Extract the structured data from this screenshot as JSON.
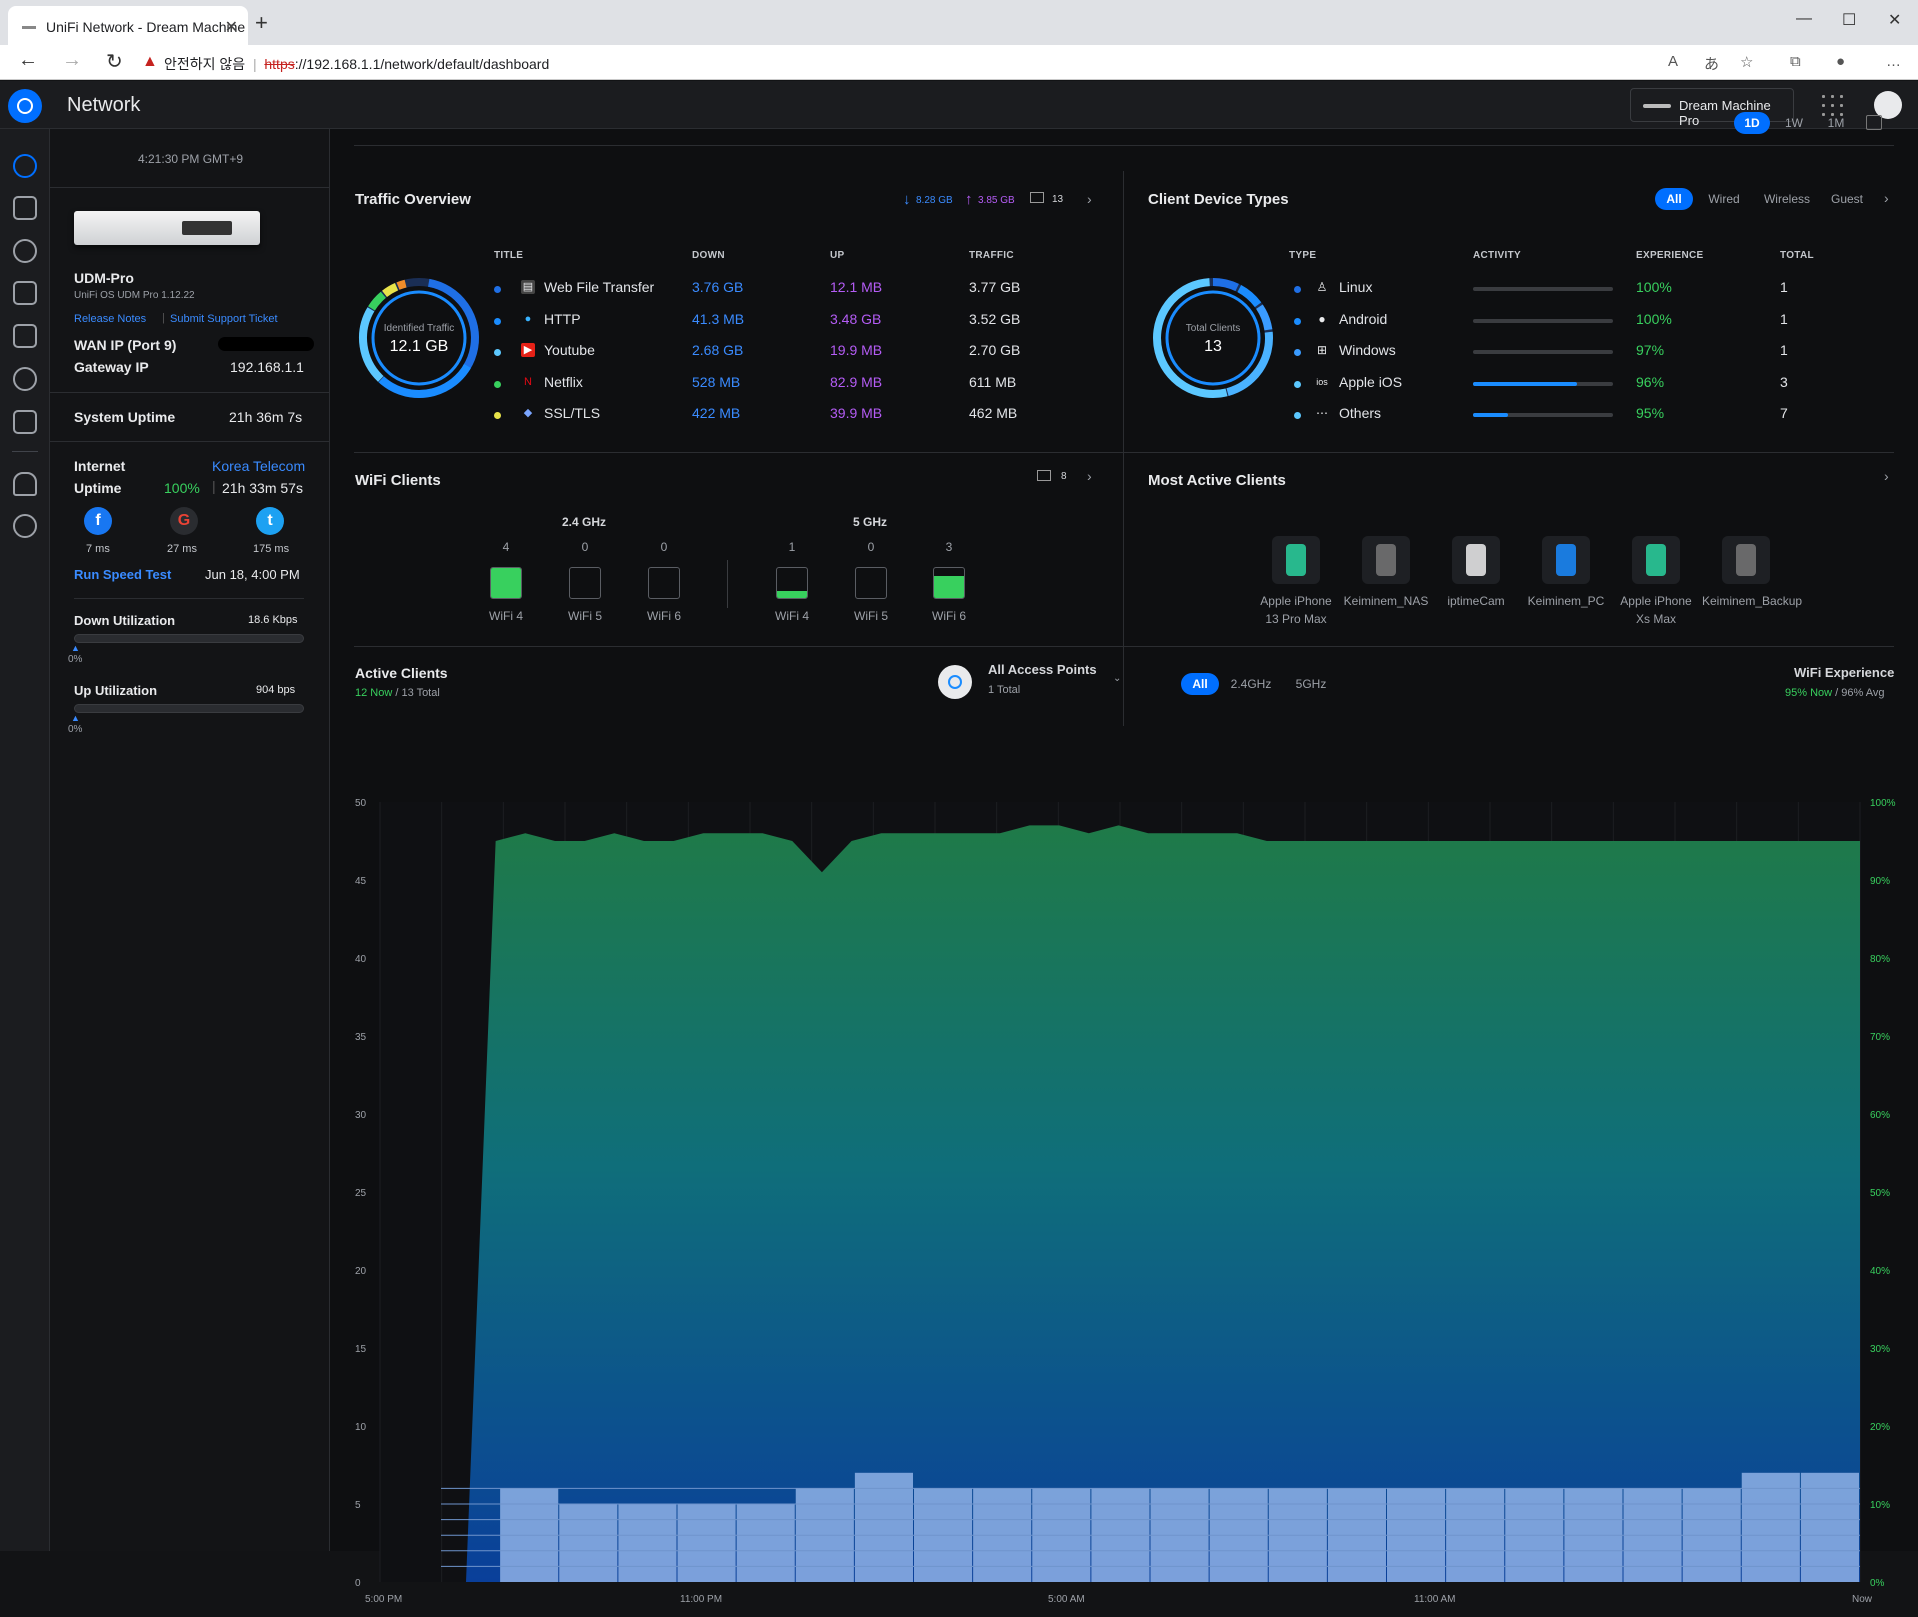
{
  "browser": {
    "tab_title": "UniFi Network - Dream Machine",
    "security_label": "안전하지 않음",
    "url_scheme": "https",
    "url_rest": "://192.168.1.1/network/default/dashboard"
  },
  "app": {
    "name": "Network",
    "device_button": "Dream Machine Pro",
    "colors": {
      "accent": "#006fff",
      "green": "#38d05e",
      "purple": "#b45cf5"
    }
  },
  "left": {
    "time": "4:21:30 PM GMT+9",
    "device_name": "UDM-Pro",
    "device_os": "UniFi OS UDM Pro 1.12.22",
    "release_notes": "Release Notes",
    "support": "Submit Support Ticket",
    "wan_label": "WAN IP (Port 9)",
    "gateway_label": "Gateway IP",
    "gateway_value": "192.168.1.1",
    "sys_uptime_label": "System Uptime",
    "sys_uptime_value": "21h 36m 7s",
    "internet_label": "Internet",
    "isp": "Korea Telecom",
    "uptime_label": "Uptime",
    "uptime_pct": "100%",
    "uptime_value": "21h 33m 57s",
    "latency": [
      {
        "name": "facebook-icon",
        "ms": "7 ms"
      },
      {
        "name": "google-icon",
        "ms": "27 ms"
      },
      {
        "name": "twitter-icon",
        "ms": "175 ms"
      }
    ],
    "speedtest_label": "Run Speed Test",
    "speedtest_date": "Jun 18, 4:00 PM",
    "down_label": "Down Utilization",
    "down_value": "18.6 Kbps",
    "down_pct": "0%",
    "up_label": "Up Utilization",
    "up_value": "904 bps",
    "up_pct": "0%"
  },
  "range": {
    "buttons": [
      "1D",
      "1W",
      "1M"
    ],
    "selected": "1D"
  },
  "traffic": {
    "title": "Traffic Overview",
    "down_total": "8.28 GB",
    "up_total": "3.85 GB",
    "clients": "13",
    "donut_label": "Identified Traffic",
    "donut_value": "12.1 GB",
    "headers": [
      "TITLE",
      "DOWN",
      "UP",
      "TRAFFIC"
    ],
    "rows": [
      {
        "title": "Web File Transfer",
        "down": "3.76 GB",
        "up": "12.1 MB",
        "traffic": "3.77 GB",
        "dot": "#1f6fe5",
        "icon": "file-transfer-icon"
      },
      {
        "title": "HTTP",
        "down": "41.3 MB",
        "up": "3.48 GB",
        "traffic": "3.52 GB",
        "dot": "#1a8cff",
        "icon": "globe-icon"
      },
      {
        "title": "Youtube",
        "down": "2.68 GB",
        "up": "19.9 MB",
        "traffic": "2.70 GB",
        "dot": "#5cc8ff",
        "icon": "youtube-icon"
      },
      {
        "title": "Netflix",
        "down": "528 MB",
        "up": "82.9 MB",
        "traffic": "611 MB",
        "dot": "#38d05e",
        "icon": "netflix-icon"
      },
      {
        "title": "SSL/TLS",
        "down": "422 MB",
        "up": "39.9 MB",
        "traffic": "462 MB",
        "dot": "#e8e34a",
        "icon": "shield-icon"
      }
    ]
  },
  "client_types": {
    "title": "Client Device Types",
    "filters": [
      "All",
      "Wired",
      "Wireless",
      "Guest"
    ],
    "donut_label": "Total Clients",
    "donut_value": "13",
    "headers": [
      "TYPE",
      "ACTIVITY",
      "EXPERIENCE",
      "TOTAL"
    ],
    "rows": [
      {
        "type": "Linux",
        "activity": 0.0,
        "experience": "100%",
        "total": "1",
        "dot": "#1f6fe5",
        "icon": "linux-icon"
      },
      {
        "type": "Android",
        "activity": 0.0,
        "experience": "100%",
        "total": "1",
        "dot": "#1a8cff",
        "icon": "android-icon"
      },
      {
        "type": "Windows",
        "activity": 0.0,
        "experience": "97%",
        "total": "1",
        "dot": "#3a9bff",
        "icon": "windows-icon"
      },
      {
        "type": "Apple iOS",
        "activity": 0.74,
        "experience": "96%",
        "total": "3",
        "dot": "#5cc8ff",
        "icon": "ios-icon"
      },
      {
        "type": "Others",
        "activity": 0.25,
        "experience": "95%",
        "total": "7",
        "dot": "#5cc8ff",
        "icon": "others-icon"
      }
    ]
  },
  "wifi": {
    "title": "WiFi Clients",
    "count": "8",
    "band24": "2.4 GHz",
    "band5": "5 GHz",
    "groups": [
      {
        "label": "WiFi 4",
        "count": "4",
        "fill": 1.0
      },
      {
        "label": "WiFi 5",
        "count": "0",
        "fill": 0.0
      },
      {
        "label": "WiFi 6",
        "count": "0",
        "fill": 0.0
      },
      {
        "label": "WiFi 4",
        "count": "1",
        "fill": 0.25
      },
      {
        "label": "WiFi 5",
        "count": "0",
        "fill": 0.0
      },
      {
        "label": "WiFi 6",
        "count": "3",
        "fill": 0.75
      }
    ]
  },
  "most_active": {
    "title": "Most Active Clients",
    "clients": [
      {
        "name": "Apple iPhone 13 Pro Max",
        "icon": "iphone-icon"
      },
      {
        "name": "Keiminem_NAS",
        "icon": "nas-icon"
      },
      {
        "name": "iptimeCam",
        "icon": "camera-icon"
      },
      {
        "name": "Keiminem_PC",
        "icon": "pc-icon"
      },
      {
        "name": "Apple iPhone Xs Max",
        "icon": "iphone-icon"
      },
      {
        "name": "Keiminem_Backup",
        "icon": "nas-icon"
      }
    ]
  },
  "active_clients": {
    "title": "Active Clients",
    "now": "12 Now",
    "total": "/ 13 Total",
    "ap_label": "All Access Points",
    "ap_total": "1 Total",
    "bands": [
      "All",
      "2.4GHz",
      "5GHz"
    ],
    "wifi_exp_title": "WiFi Experience",
    "wifi_exp_now": "95% Now",
    "wifi_exp_avg": "/ 96% Avg"
  },
  "chart_data": {
    "type": "area",
    "x_ticks": [
      "5:00 PM",
      "11:00 PM",
      "5:00 AM",
      "11:00 AM",
      "Now"
    ],
    "y_left": {
      "ticks": [
        "50",
        "45",
        "40",
        "35",
        "30",
        "25",
        "20",
        "15",
        "10",
        "5",
        "0"
      ],
      "ylim": [
        0,
        50
      ]
    },
    "y_right": {
      "ticks": [
        "100%",
        "90%",
        "80%",
        "70%",
        "60%",
        "50%",
        "40%",
        "30%",
        "20%",
        "10%",
        "0%"
      ],
      "ylim": [
        0,
        100
      ]
    },
    "series": [
      {
        "name": "WiFi Experience",
        "unit": "%",
        "values": [
          0,
          95,
          96,
          95,
          95,
          96,
          95,
          95,
          96,
          96,
          96,
          95,
          91,
          95,
          96,
          96,
          96,
          96,
          96,
          97,
          97,
          96,
          97,
          96,
          96,
          96,
          96,
          95,
          95,
          95,
          95,
          95,
          95,
          95,
          95,
          95,
          95,
          95,
          95,
          95,
          95,
          95,
          95,
          95,
          95,
          95,
          95,
          95
        ]
      },
      {
        "name": "Active Clients",
        "values": [
          0,
          6,
          5,
          5,
          5,
          5,
          6,
          7,
          6,
          6,
          6,
          6,
          6,
          6,
          6,
          6,
          6,
          6,
          6,
          6,
          6,
          6,
          7,
          7
        ]
      }
    ]
  }
}
